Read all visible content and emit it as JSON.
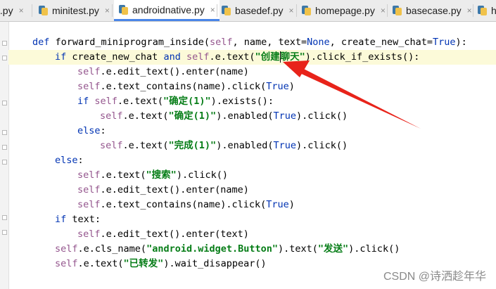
{
  "tabs": [
    {
      "label": "t.py",
      "active": false
    },
    {
      "label": "minitest.py",
      "active": false
    },
    {
      "label": "androidnative.py",
      "active": true
    },
    {
      "label": "basedef.py",
      "active": false
    },
    {
      "label": "homepage.py",
      "active": false
    },
    {
      "label": "basecase.py",
      "active": false
    },
    {
      "label": "h",
      "active": false
    }
  ],
  "tab_close_glyph": "×",
  "code": {
    "def_kw": "def",
    "func_sig": " forward_miniprogram_inside(",
    "sig_self": "self",
    "sig_rest1": ", name, text=",
    "sig_none": "None",
    "sig_rest2": ", create_new_chat=",
    "sig_true": "True",
    "sig_end": "):",
    "if_kw": "if",
    "and_kw": "and",
    "else_kw": "else",
    "self_kw": "self",
    "true_kw": "True",
    "l2_a": " create_new_chat ",
    "l2_b": ".e.text(",
    "l2_str1": "\"创建",
    "l2_str2": "聊天\"",
    "l2_c": ").click_if_exists():",
    "l3": ".e.edit_text().enter(name)",
    "l4_a": ".e.text_contains(name).click(",
    "l4_b": ")",
    "l5_a": ".e.text(",
    "l5_str": "\"确定(1)\"",
    "l5_b": ").exists():",
    "l6_a": ".e.text(",
    "l6_str": "\"确定(1)\"",
    "l6_b": ").enabled(",
    "l6_c": ").click()",
    "colon": ":",
    "l8_a": ".e.text(",
    "l8_str": "\"完成(1)\"",
    "l8_b": ").enabled(",
    "l8_c": ").click()",
    "l10_a": ".e.text(",
    "l10_str": "\"搜索\"",
    "l10_b": ").click()",
    "l11": ".e.edit_text().enter(name)",
    "l12_a": ".e.text_contains(name).click(",
    "l12_b": ")",
    "l13": " text:",
    "l14": ".e.edit_text().enter(text)",
    "l15_a": ".e.cls_name(",
    "l15_str": "\"android.widget.Button\"",
    "l15_b": ").text(",
    "l15_str2": "\"发送\"",
    "l15_c": ").click()",
    "l16_a": ".e.text(",
    "l16_str": "\"已转发\"",
    "l16_b": ").wait_disappear()"
  },
  "annotation_arrow_color": "#e8231a",
  "watermark": "CSDN @诗洒趁年华"
}
